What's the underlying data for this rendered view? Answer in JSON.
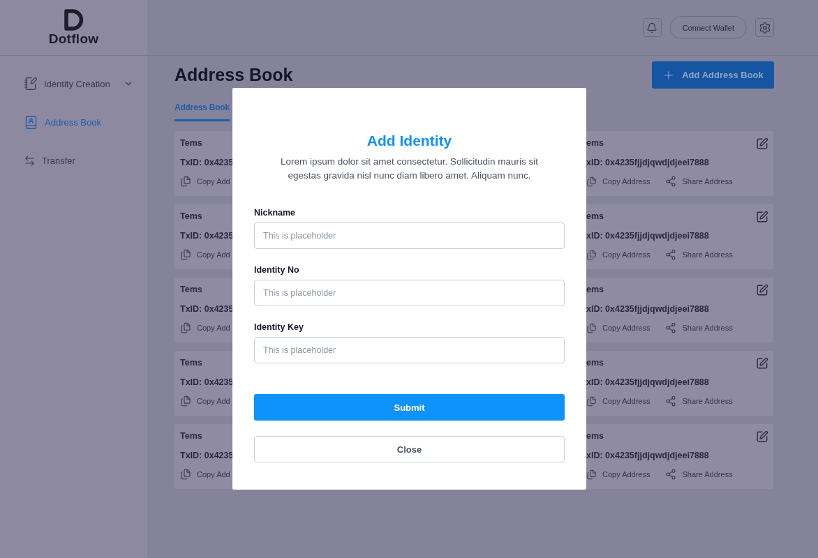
{
  "brand": {
    "name": "Dotflow"
  },
  "sidebar": {
    "items": [
      {
        "label": "Identity Creation",
        "selected": false,
        "kind": "dropdown"
      },
      {
        "label": "Address Book",
        "selected": true,
        "kind": "book"
      },
      {
        "label": "Transfer",
        "selected": false,
        "kind": "transfer"
      }
    ]
  },
  "header": {
    "connect_button": "Connect Wallet"
  },
  "page": {
    "title": "Address Book",
    "add_button": "Add Address Book",
    "tabs": [
      {
        "label": "Address Book",
        "selected": true
      }
    ]
  },
  "cards_left": [
    {
      "name": "Tems",
      "txid": "TxID: 0x4235",
      "action": "Copy Add"
    },
    {
      "name": "Tems",
      "txid": "TxID: 0x4235",
      "action": "Copy Add"
    },
    {
      "name": "Tems",
      "txid": "TxID: 0x4235",
      "action": "Copy Add"
    },
    {
      "name": "Tems",
      "txid": "TxID: 0x4235",
      "action": "Copy Add"
    },
    {
      "name": "Tems",
      "txid": "TxID: 0x4235",
      "action": "Copy Add"
    }
  ],
  "cards_right": [
    {
      "name": "ems",
      "txid": "xID: 0x4235fjjdjqwdjdjeei7888",
      "copy": "Copy Address",
      "share": "Share Address"
    },
    {
      "name": "ems",
      "txid": "xID: 0x4235fjjdjqwdjdjeei7888",
      "copy": "Copy Address",
      "share": "Share Address"
    },
    {
      "name": "ems",
      "txid": "xID: 0x4235fjjdjqwdjdjeei7888",
      "copy": "Copy Address",
      "share": "Share Address"
    },
    {
      "name": "ems",
      "txid": "xID: 0x4235fjjdjqwdjdjeei7888",
      "copy": "Copy Address",
      "share": "Share Address"
    },
    {
      "name": "ems",
      "txid": "xID: 0x4235fjjdjqwdjdjeei7888",
      "copy": "Copy Address",
      "share": "Share Address"
    }
  ],
  "modal": {
    "title": "Add Identity",
    "description": "Lorem ipsum dolor sit amet consectetur. Sollicitudin mauris sit egestas gravida nisl nunc diam libero amet. Aliquam nunc.",
    "fields": [
      {
        "label": "Nickname",
        "placeholder": "This is placeholder"
      },
      {
        "label": "Identity No",
        "placeholder": "This is placeholder"
      },
      {
        "label": "Identity Key",
        "placeholder": "This is placeholder"
      }
    ],
    "submit": "Submit",
    "close": "Close"
  }
}
